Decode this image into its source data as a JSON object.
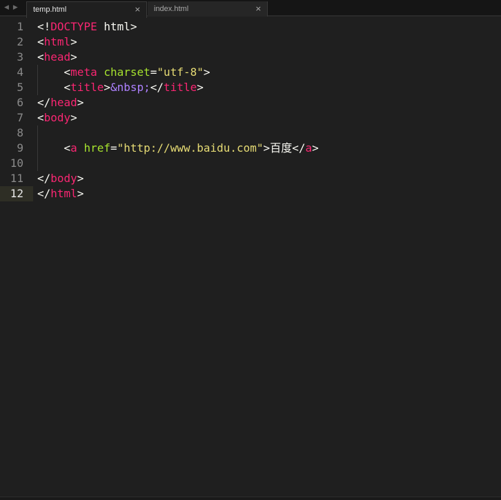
{
  "nav": {
    "back_glyph": "◀",
    "forward_glyph": "▶"
  },
  "tabs": [
    {
      "label": "temp.html",
      "close_glyph": "×",
      "active": true
    },
    {
      "label": "index.html",
      "close_glyph": "×",
      "active": false
    }
  ],
  "editor": {
    "current_line": 12,
    "lines": [
      {
        "number": "1",
        "tokens": [
          [
            "t-punct",
            "<!"
          ],
          [
            "t-tag",
            "DOCTYPE"
          ],
          [
            "t-text",
            " html"
          ],
          [
            "t-punct",
            ">"
          ]
        ]
      },
      {
        "number": "2",
        "tokens": [
          [
            "t-punct",
            "<"
          ],
          [
            "t-tag",
            "html"
          ],
          [
            "t-punct",
            ">"
          ]
        ]
      },
      {
        "number": "3",
        "tokens": [
          [
            "t-punct",
            "<"
          ],
          [
            "t-tag",
            "head"
          ],
          [
            "t-punct",
            ">"
          ]
        ]
      },
      {
        "number": "4",
        "tokens": [
          [
            "t-text",
            "    "
          ],
          [
            "t-punct",
            "<"
          ],
          [
            "t-tag",
            "meta"
          ],
          [
            "t-text",
            " "
          ],
          [
            "t-attr",
            "charset"
          ],
          [
            "t-punct",
            "="
          ],
          [
            "t-str",
            "\"utf-8\""
          ],
          [
            "t-punct",
            ">"
          ]
        ]
      },
      {
        "number": "5",
        "tokens": [
          [
            "t-text",
            "    "
          ],
          [
            "t-punct",
            "<"
          ],
          [
            "t-tag",
            "title"
          ],
          [
            "t-punct",
            ">"
          ],
          [
            "t-ent",
            "&nbsp;"
          ],
          [
            "t-punct",
            "</"
          ],
          [
            "t-tag",
            "title"
          ],
          [
            "t-punct",
            ">"
          ]
        ]
      },
      {
        "number": "6",
        "tokens": [
          [
            "t-punct",
            "</"
          ],
          [
            "t-tag",
            "head"
          ],
          [
            "t-punct",
            ">"
          ]
        ]
      },
      {
        "number": "7",
        "tokens": [
          [
            "t-punct",
            "<"
          ],
          [
            "t-tag",
            "body"
          ],
          [
            "t-punct",
            ">"
          ]
        ]
      },
      {
        "number": "8",
        "tokens": []
      },
      {
        "number": "9",
        "tokens": [
          [
            "t-text",
            "    "
          ],
          [
            "t-punct",
            "<"
          ],
          [
            "t-tag",
            "a"
          ],
          [
            "t-text",
            " "
          ],
          [
            "t-attr",
            "href"
          ],
          [
            "t-punct",
            "="
          ],
          [
            "t-str",
            "\"http://www.baidu.com\""
          ],
          [
            "t-punct",
            ">"
          ],
          [
            "t-text",
            "百度"
          ],
          [
            "t-punct",
            "</"
          ],
          [
            "t-tag",
            "a"
          ],
          [
            "t-punct",
            ">"
          ]
        ]
      },
      {
        "number": "10",
        "tokens": []
      },
      {
        "number": "11",
        "tokens": [
          [
            "t-punct",
            "</"
          ],
          [
            "t-tag",
            "body"
          ],
          [
            "t-punct",
            ">"
          ]
        ]
      },
      {
        "number": "12",
        "tokens": [
          [
            "t-punct",
            "</"
          ],
          [
            "t-tag",
            "html"
          ],
          [
            "t-punct",
            ">"
          ]
        ]
      }
    ]
  }
}
